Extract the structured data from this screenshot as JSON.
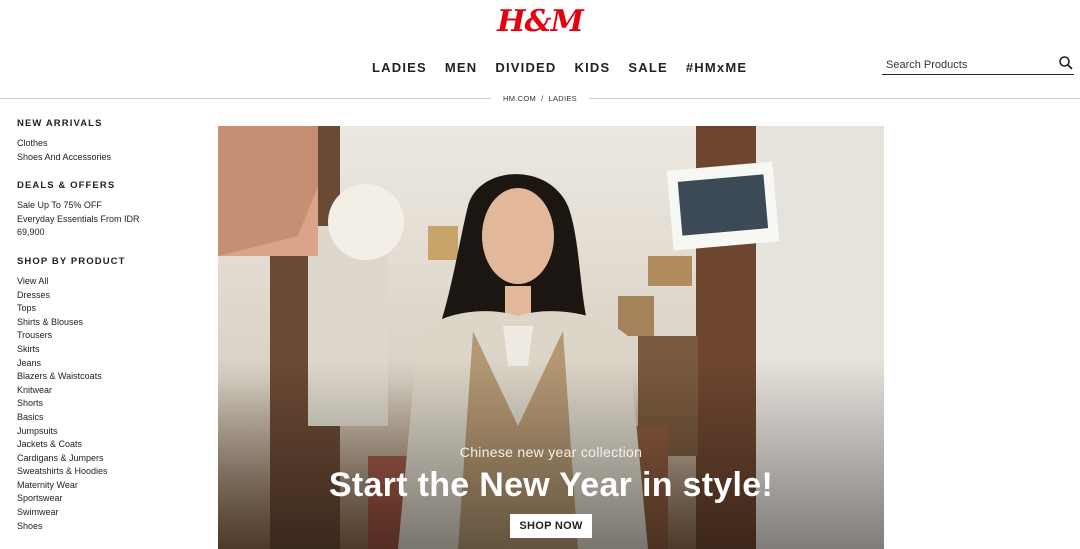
{
  "brand": {
    "logo": "H&M"
  },
  "nav": {
    "items": [
      "LADIES",
      "MEN",
      "DIVIDED",
      "KIDS",
      "SALE",
      "#HMxME"
    ]
  },
  "search": {
    "placeholder": "Search Products"
  },
  "breadcrumb": {
    "home": "HM.COM",
    "separator": "/",
    "current": "LADIES"
  },
  "sidebar": {
    "new_arrivals": {
      "heading": "NEW ARRIVALS",
      "items": [
        "Clothes",
        "Shoes And Accessories"
      ]
    },
    "deals": {
      "heading": "DEALS & OFFERS",
      "items": [
        "Sale Up To 75% OFF",
        "Everyday Essentials From IDR",
        "69,900"
      ]
    },
    "shop_by_product": {
      "heading": "SHOP BY PRODUCT",
      "items": [
        "View All",
        "Dresses",
        "Tops",
        "Shirts & Blouses",
        "Trousers",
        "Skirts",
        "Jeans",
        "Blazers & Waistcoats",
        "Knitwear",
        "Shorts",
        "Basics",
        "Jumpsuits",
        "Jackets & Coats",
        "Cardigans & Jumpers",
        "Sweatshirts & Hoodies",
        "Maternity Wear",
        "Sportswear",
        "Swimwear",
        "Shoes"
      ]
    }
  },
  "hero": {
    "subtitle": "Chinese new year collection",
    "title": "Start the New Year in style!",
    "cta": "SHOP NOW"
  },
  "colors": {
    "brand_red": "#e50010"
  }
}
